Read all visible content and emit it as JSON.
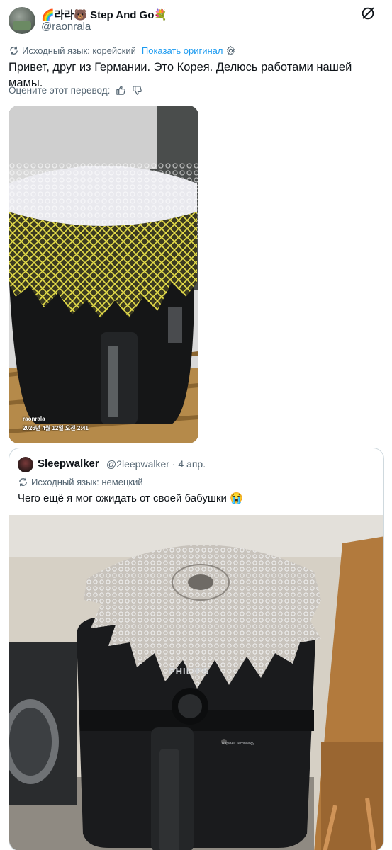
{
  "tweet": {
    "display_name": "🌈라라🐻 Step And Go💐",
    "handle": "@raonrala",
    "translation": {
      "source_label": "Исходный язык: корейский",
      "show_original": "Показать оригинал"
    },
    "text": "Привет, друг из Германии. Это Корея. Делюсь работами нашей мамы.",
    "rate_label": "Оцените этот перевод:",
    "media": {
      "watermark_user": "raonrala",
      "watermark_date": "2026년 4월 12일 오전 2:41"
    }
  },
  "quote": {
    "display_name": "Sleepwalker",
    "meta": "@2leepwalker · 4 апр.",
    "translation_label": "Исходный язык: немецкий",
    "text": "Чего ещё я мог ожидать от своей бабушки 😭",
    "media": {
      "brand": "PHILIPS",
      "tech_label": "RapidAir Technology"
    }
  }
}
